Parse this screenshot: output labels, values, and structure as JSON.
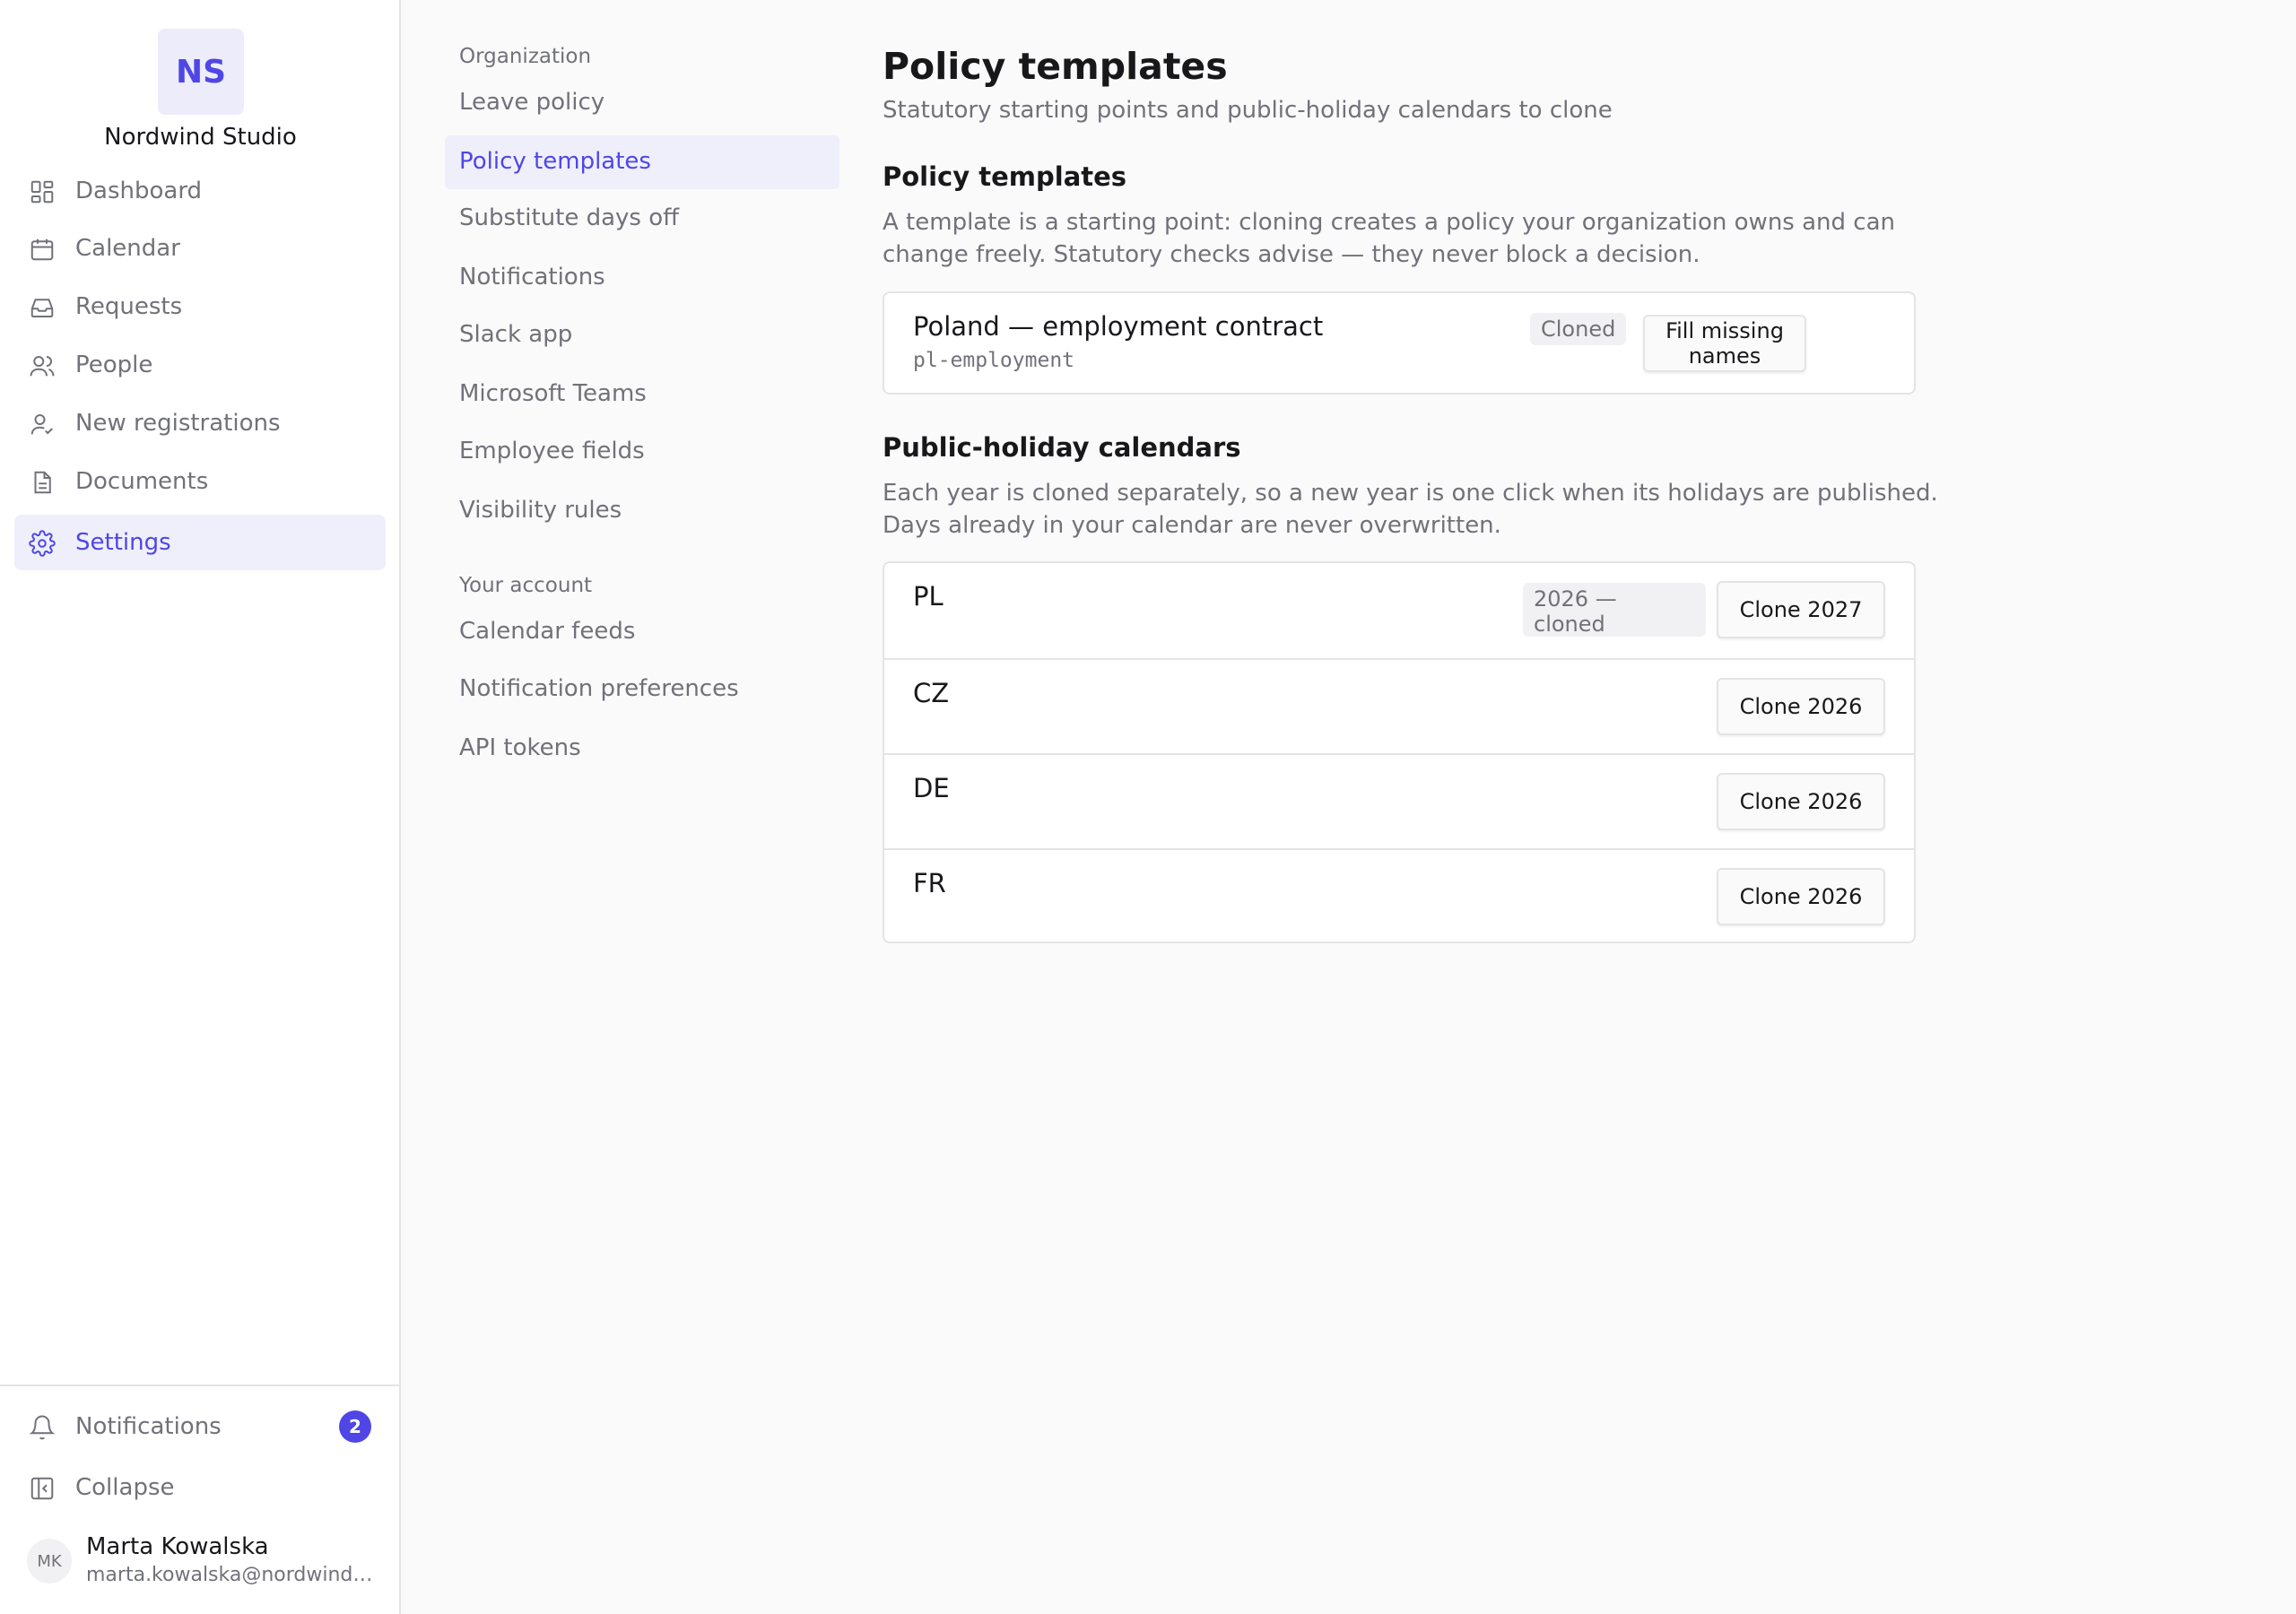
{
  "brand": {
    "initials": "NS",
    "name": "Nordwind Studio"
  },
  "nav": [
    {
      "label": "Dashboard",
      "icon": "dashboard-icon"
    },
    {
      "label": "Calendar",
      "icon": "calendar-icon"
    },
    {
      "label": "Requests",
      "icon": "inbox-icon"
    },
    {
      "label": "People",
      "icon": "people-icon"
    },
    {
      "label": "New registrations",
      "icon": "user-check-icon"
    },
    {
      "label": "Documents",
      "icon": "document-icon"
    },
    {
      "label": "Settings",
      "icon": "gear-icon",
      "active": true
    }
  ],
  "sidebar_footer": {
    "notifications_label": "Notifications",
    "notifications_count": "2",
    "collapse_label": "Collapse"
  },
  "user": {
    "initials": "MK",
    "name": "Marta Kowalska",
    "email": "marta.kowalska@nordwind.studio"
  },
  "subnav": {
    "org_heading": "Organization",
    "org_items": [
      "Leave policy",
      "Policy templates",
      "Substitute days off",
      "Notifications",
      "Slack app",
      "Microsoft Teams",
      "Employee fields",
      "Visibility rules"
    ],
    "account_heading": "Your account",
    "account_items": [
      "Calendar feeds",
      "Notification preferences",
      "API tokens"
    ],
    "active": "Policy templates"
  },
  "page": {
    "title": "Policy templates",
    "subtitle": "Statutory starting points and public-holiday calendars to clone"
  },
  "templates": {
    "title": "Policy templates",
    "description": "A template is a starting point: cloning creates a policy your organization owns and can change freely. Statutory checks advise — they never block a decision.",
    "items": [
      {
        "name": "Poland — employment contract",
        "code": "pl-employment",
        "status": "Cloned",
        "action": "Fill missing names"
      }
    ]
  },
  "holidays": {
    "title": "Public-holiday calendars",
    "description": "Each year is cloned separately, so a new year is one click when its holidays are published. Days already in your calendar are never overwritten.",
    "rows": [
      {
        "code": "PL",
        "status": "2026 — cloned",
        "action": "Clone 2027"
      },
      {
        "code": "CZ",
        "status": "",
        "action": "Clone 2026"
      },
      {
        "code": "DE",
        "status": "",
        "action": "Clone 2026"
      },
      {
        "code": "FR",
        "status": "",
        "action": "Clone 2026"
      }
    ]
  },
  "colors": {
    "accent": "#4f46e5",
    "accent_bg": "#efeffb",
    "muted_text": "#71717a",
    "border": "#e4e4e7"
  }
}
